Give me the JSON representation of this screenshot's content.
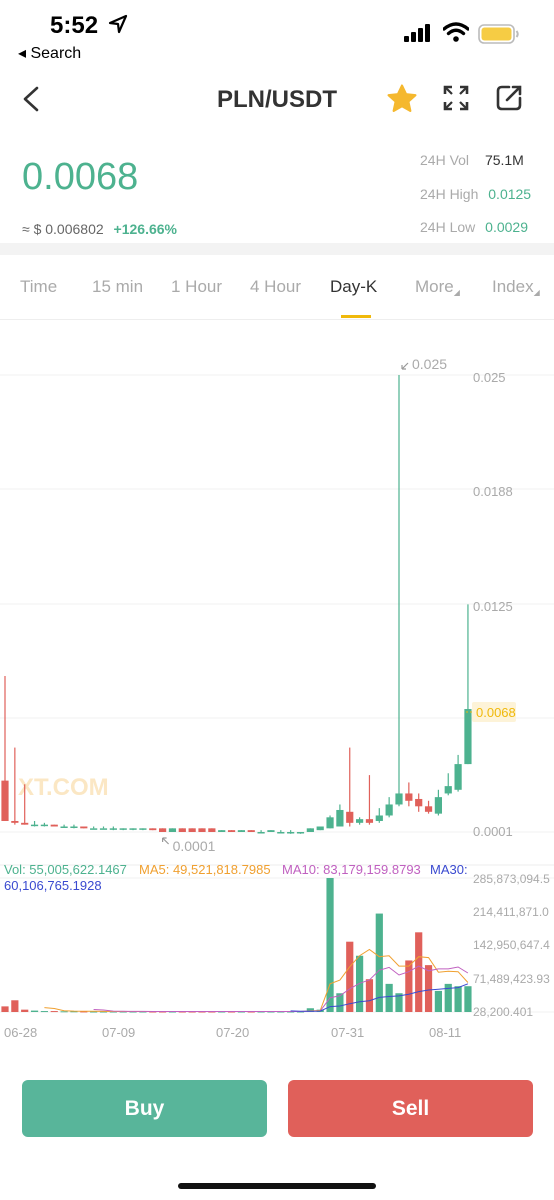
{
  "status_bar": {
    "time": "5:52",
    "back_label": "◂ Search"
  },
  "nav": {
    "title": "PLN/USDT"
  },
  "ticker": {
    "price": "0.0068",
    "approx_prefix": "≈ $",
    "approx_value": "0.006802",
    "change": "+126.66%",
    "vol_label": "24H Vol",
    "vol_value": "75.1M",
    "high_label": "24H High",
    "high_value": "0.0125",
    "low_label": "24H Low",
    "low_value": "0.0029"
  },
  "tabs": [
    {
      "label": "Time"
    },
    {
      "label": "15 min"
    },
    {
      "label": "1 Hour"
    },
    {
      "label": "4 Hour"
    },
    {
      "label": "Day-K"
    },
    {
      "label": "More"
    },
    {
      "label": "Index"
    }
  ],
  "active_tab": "Day-K",
  "watermark": "XT.COM",
  "buttons": {
    "buy": "Buy",
    "sell": "Sell"
  },
  "colors": {
    "up": "#4db28f",
    "down": "#e0605a",
    "accent": "#f0b90b",
    "ma5": "#f0a030",
    "ma10": "#c060c0",
    "ma30": "#3a4ad0"
  },
  "chart_data": {
    "type": "candlestick",
    "price_axis_labels": [
      "0.025",
      "0.0188",
      "0.0125",
      "0.0068",
      "0.0001"
    ],
    "max_label": "0.025",
    "min_label": "0.0001",
    "current_price_label": "0.0068",
    "volume_axis_labels": [
      "285,873,094.5",
      "214,411,871.0",
      "142,950,647.4",
      "71,489,423.93",
      "28,200.401"
    ],
    "date_labels": [
      "06-28",
      "07-09",
      "07-20",
      "07-31",
      "08-11"
    ],
    "vol_legend": {
      "vol": "Vol: 55,005,622.1467",
      "ma5": "MA5: 49,521,818.7985",
      "ma10": "MA10: 83,179,159.8793",
      "ma30": "MA30: 60,106,765.1928"
    },
    "candles": [
      {
        "o": 0.0029,
        "h": 0.0086,
        "l": 0.0007,
        "c": 0.0007
      },
      {
        "o": 0.0007,
        "h": 0.0047,
        "l": 0.0005,
        "c": 0.0006
      },
      {
        "o": 0.0006,
        "h": 0.0027,
        "l": 0.0005,
        "c": 0.0005
      },
      {
        "o": 0.0005,
        "h": 0.0007,
        "l": 0.0004,
        "c": 0.0005
      },
      {
        "o": 0.0005,
        "h": 0.0006,
        "l": 0.0004,
        "c": 0.0005
      },
      {
        "o": 0.0005,
        "h": 0.0005,
        "l": 0.0004,
        "c": 0.0004
      },
      {
        "o": 0.0004,
        "h": 0.0005,
        "l": 0.0004,
        "c": 0.0004
      },
      {
        "o": 0.0004,
        "h": 0.0005,
        "l": 0.0003,
        "c": 0.0004
      },
      {
        "o": 0.0004,
        "h": 0.0004,
        "l": 0.0003,
        "c": 0.0003
      },
      {
        "o": 0.0003,
        "h": 0.0004,
        "l": 0.0003,
        "c": 0.0003
      },
      {
        "o": 0.0003,
        "h": 0.0004,
        "l": 0.0003,
        "c": 0.0003
      },
      {
        "o": 0.0003,
        "h": 0.0004,
        "l": 0.0002,
        "c": 0.0003
      },
      {
        "o": 0.0003,
        "h": 0.0003,
        "l": 0.0002,
        "c": 0.0003
      },
      {
        "o": 0.0003,
        "h": 0.0003,
        "l": 0.0002,
        "c": 0.0003
      },
      {
        "o": 0.0003,
        "h": 0.0003,
        "l": 0.0002,
        "c": 0.0003
      },
      {
        "o": 0.0003,
        "h": 0.0003,
        "l": 0.0002,
        "c": 0.0002
      },
      {
        "o": 0.0003,
        "h": 0.0003,
        "l": 0.0001,
        "c": 0.0001
      },
      {
        "o": 0.0001,
        "h": 0.0003,
        "l": 0.0001,
        "c": 0.0003
      },
      {
        "o": 0.0003,
        "h": 0.0003,
        "l": 0.0001,
        "c": 0.0001
      },
      {
        "o": 0.0003,
        "h": 0.0003,
        "l": 0.0001,
        "c": 0.0001
      },
      {
        "o": 0.0003,
        "h": 0.0003,
        "l": 0.0001,
        "c": 0.0001
      },
      {
        "o": 0.0003,
        "h": 0.0003,
        "l": 0.0001,
        "c": 0.0001
      },
      {
        "o": 0.0001,
        "h": 0.0002,
        "l": 0.0001,
        "c": 0.0002
      },
      {
        "o": 0.0002,
        "h": 0.0002,
        "l": 0.0001,
        "c": 0.0001
      },
      {
        "o": 0.0001,
        "h": 0.0002,
        "l": 0.0001,
        "c": 0.0002
      },
      {
        "o": 0.0002,
        "h": 0.0002,
        "l": 0.0001,
        "c": 0.0001
      },
      {
        "o": 0.0001,
        "h": 0.0002,
        "l": 0.0001,
        "c": 0.0001
      },
      {
        "o": 0.0001,
        "h": 0.0002,
        "l": 0.0001,
        "c": 0.0002
      },
      {
        "o": 0.0001,
        "h": 0.0002,
        "l": 0.0001,
        "c": 0.0001
      },
      {
        "o": 0.0001,
        "h": 0.0002,
        "l": 0.0,
        "c": 0.0001
      },
      {
        "o": 0.0001,
        "h": 0.0001,
        "l": 0.0,
        "c": 0.0001
      },
      {
        "o": 0.0001,
        "h": 0.0003,
        "l": 0.0001,
        "c": 0.0003
      },
      {
        "o": 0.0002,
        "h": 0.0004,
        "l": 0.0002,
        "c": 0.0004
      },
      {
        "o": 0.0003,
        "h": 0.001,
        "l": 0.0003,
        "c": 0.0009
      },
      {
        "o": 0.0004,
        "h": 0.0016,
        "l": 0.0004,
        "c": 0.0013
      },
      {
        "o": 0.0012,
        "h": 0.0047,
        "l": 0.0004,
        "c": 0.0006
      },
      {
        "o": 0.0006,
        "h": 0.0009,
        "l": 0.0005,
        "c": 0.0008
      },
      {
        "o": 0.0008,
        "h": 0.0032,
        "l": 0.0005,
        "c": 0.0006
      },
      {
        "o": 0.0007,
        "h": 0.0014,
        "l": 0.0006,
        "c": 0.001
      },
      {
        "o": 0.001,
        "h": 0.002,
        "l": 0.0009,
        "c": 0.0016
      },
      {
        "o": 0.0016,
        "h": 0.025,
        "l": 0.0015,
        "c": 0.0022
      },
      {
        "o": 0.0022,
        "h": 0.0028,
        "l": 0.0015,
        "c": 0.0018
      },
      {
        "o": 0.0019,
        "h": 0.0022,
        "l": 0.0012,
        "c": 0.0015
      },
      {
        "o": 0.0015,
        "h": 0.0018,
        "l": 0.0011,
        "c": 0.0012
      },
      {
        "o": 0.0011,
        "h": 0.0024,
        "l": 0.001,
        "c": 0.002
      },
      {
        "o": 0.0022,
        "h": 0.0033,
        "l": 0.0021,
        "c": 0.0026
      },
      {
        "o": 0.0024,
        "h": 0.0043,
        "l": 0.0023,
        "c": 0.0038
      },
      {
        "o": 0.0038,
        "h": 0.0125,
        "l": 0.0038,
        "c": 0.0068
      }
    ],
    "volumes": [
      12000000,
      25000000,
      5000000,
      3000000,
      2000000,
      2000000,
      1500000,
      1500000,
      1200000,
      1000000,
      1000000,
      1000000,
      1000000,
      1000000,
      1000000,
      1000000,
      1000000,
      1000000,
      1000000,
      1000000,
      1000000,
      1000000,
      1000000,
      1000000,
      1000000,
      1000000,
      1000000,
      1000000,
      1000000,
      1000000,
      1000000,
      8000000,
      5000000,
      285873094,
      40000000,
      150000000,
      120000000,
      70000000,
      210000000,
      60000000,
      40000000,
      110000000,
      170000000,
      100000000,
      45000000,
      60000000,
      55000000,
      55005622
    ],
    "ma5": [
      null,
      null,
      null,
      null,
      9400000,
      7400000,
      2700000,
      2000000,
      1640000,
      1440000,
      1240000,
      1140000,
      1040000,
      1000000,
      1000000,
      1000000,
      1000000,
      1000000,
      1000000,
      1000000,
      1000000,
      1000000,
      1000000,
      1000000,
      1000000,
      1000000,
      1000000,
      1000000,
      1000000,
      1000000,
      1000000,
      2400000,
      3200000,
      60200000,
      68000000,
      96700000,
      120100000,
      133300000,
      118000000,
      120000000,
      98000000,
      98000000,
      118000000,
      116000000,
      85000000,
      87000000,
      86000000,
      63000000
    ],
    "ma10": [
      null,
      null,
      null,
      null,
      null,
      null,
      null,
      null,
      null,
      5420000,
      4320000,
      1920000,
      1520000,
      1320000,
      1220000,
      1120000,
      1070000,
      1020000,
      1000000,
      1000000,
      1000000,
      1000000,
      1000000,
      1000000,
      1000000,
      1000000,
      1000000,
      1000000,
      1000000,
      1000000,
      1000000,
      1700000,
      2100000,
      30600000,
      34500000,
      49400000,
      61300000,
      68300000,
      89200000,
      95100000,
      79000000,
      86000000,
      98000000,
      88000000,
      92000000,
      92000000,
      96000000,
      83179159
    ],
    "ma30": [
      null,
      null,
      null,
      null,
      null,
      null,
      null,
      null,
      null,
      null,
      null,
      null,
      null,
      null,
      null,
      null,
      null,
      null,
      null,
      null,
      null,
      null,
      null,
      null,
      null,
      null,
      null,
      null,
      null,
      2300000,
      1500000,
      1800000,
      2000000,
      11500000,
      12800000,
      17800000,
      21800000,
      24100000,
      31100000,
      33100000,
      34400000,
      38000000,
      43600000,
      46900000,
      48400000,
      50300000,
      52100000,
      60106765
    ]
  }
}
